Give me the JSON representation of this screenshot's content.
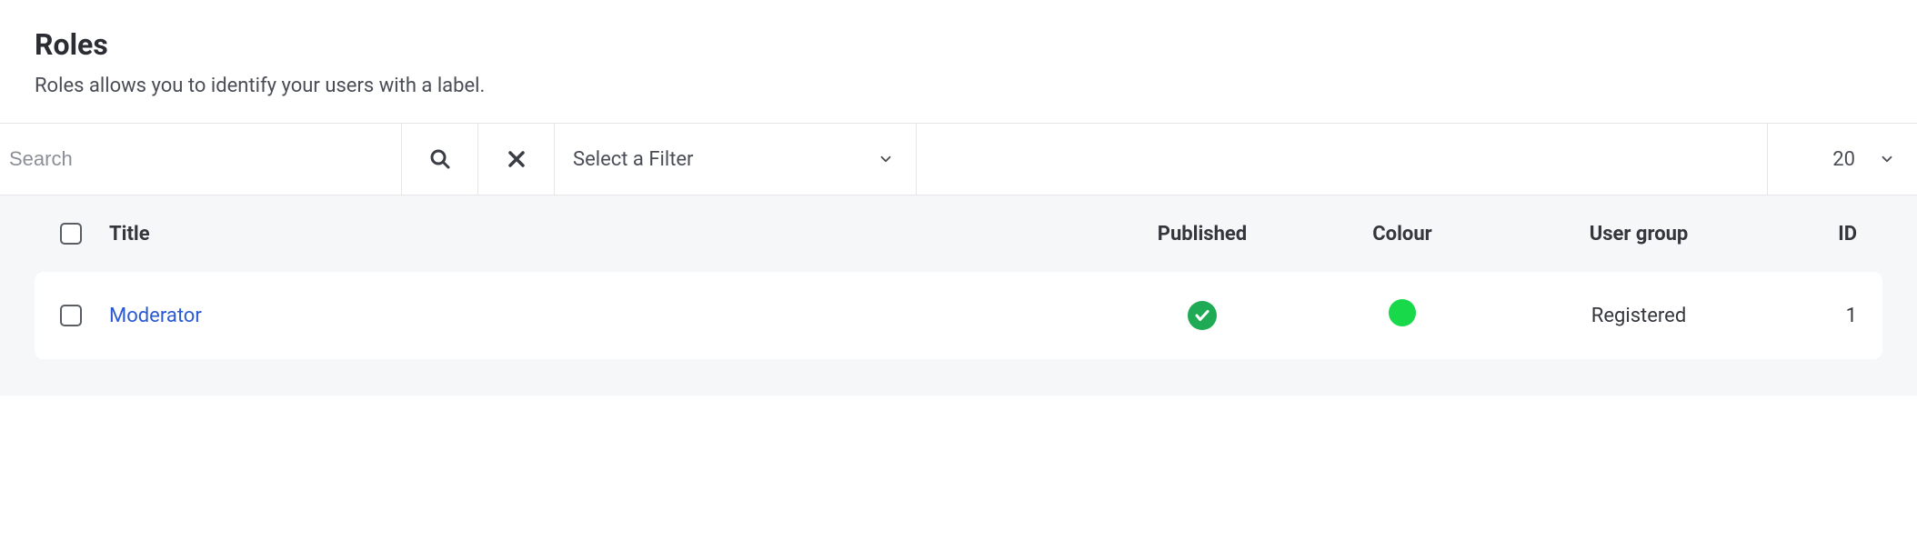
{
  "header": {
    "title": "Roles",
    "subtitle": "Roles allows you to identify your users with a label."
  },
  "toolbar": {
    "search_placeholder": "Search",
    "search_value": "",
    "filter_label": "Select a Filter",
    "page_size": "20"
  },
  "table": {
    "columns": {
      "title": "Title",
      "published": "Published",
      "colour": "Colour",
      "user_group": "User group",
      "id": "ID"
    },
    "rows": [
      {
        "title": "Moderator",
        "published": true,
        "colour": "#18d94a",
        "user_group": "Registered",
        "id": "1"
      }
    ]
  }
}
